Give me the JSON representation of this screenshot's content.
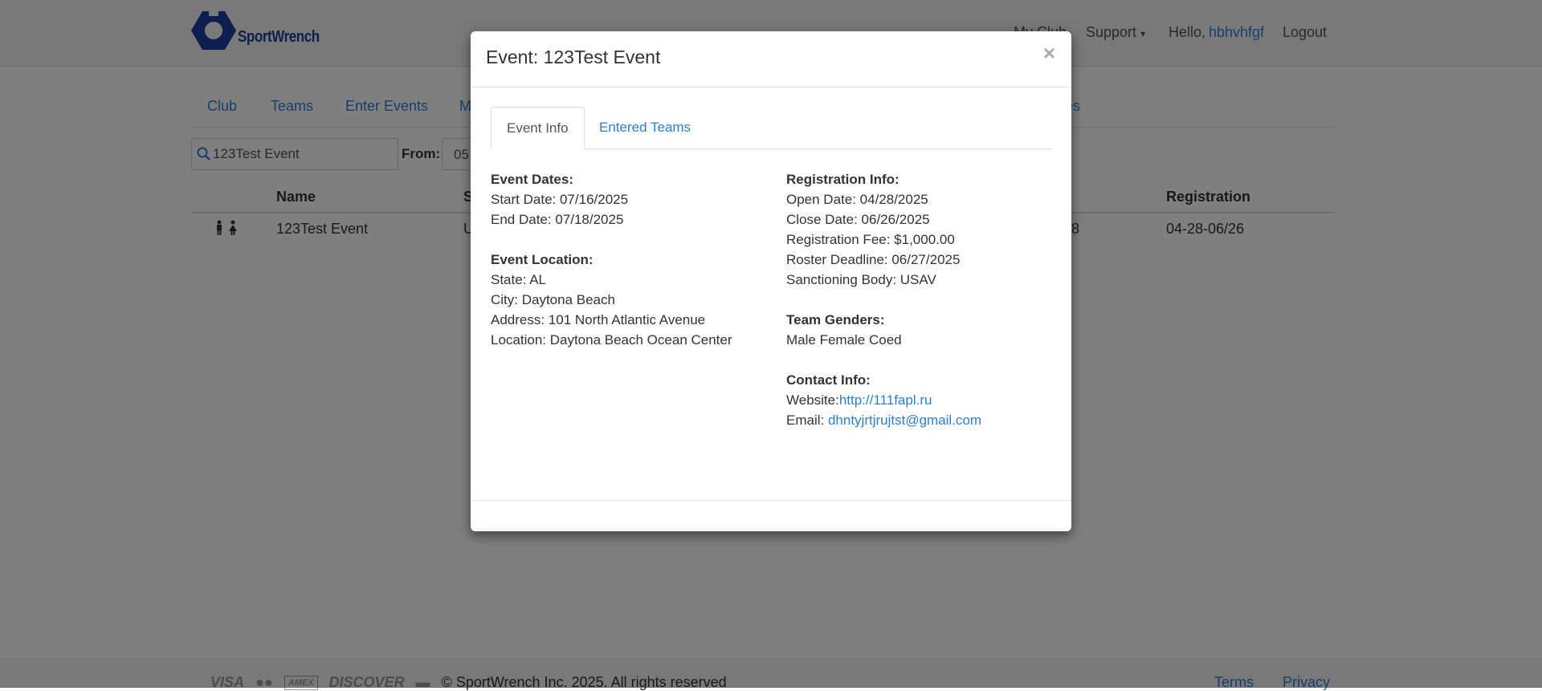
{
  "navbar": {
    "logo_text": "SportWrench",
    "my_club": "My Club",
    "support": "Support",
    "support_caret": "▾",
    "hello": "Hello,",
    "username": "hbhvhfgf",
    "logout": "Logout"
  },
  "subnav": {
    "club": "Club",
    "teams": "Teams",
    "enter_events": "Enter Events",
    "m_partial": "M",
    "es_partial": "es"
  },
  "filters": {
    "search_value": "123Test Event",
    "from_label": "From:",
    "from_value": "05"
  },
  "table": {
    "headers": {
      "name": "Name",
      "s_partial": "S",
      "registration": "Registration"
    },
    "row": {
      "name": "123Test Event",
      "u_partial": "U",
      "num_partial": "8",
      "registration": "04-28-06/26"
    }
  },
  "footer": {
    "cards": [
      "VISA",
      "●●",
      "AMEX",
      "DISCOVER",
      "▬"
    ],
    "copyright": "© SportWrench Inc. 2025. All rights reserved",
    "terms": "Terms",
    "privacy": "Privacy"
  },
  "modal": {
    "title": "Event: 123Test Event",
    "close": "×",
    "tabs": {
      "event_info": "Event Info",
      "entered_teams": "Entered Teams"
    },
    "left": {
      "dates_heading": "Event Dates:",
      "start": "Start Date: 07/16/2025",
      "end": "End Date: 07/18/2025",
      "location_heading": "Event Location:",
      "state": "State: AL",
      "city": "City: Daytona Beach",
      "address": "Address: 101 North Atlantic Avenue",
      "location": "Location: Daytona Beach Ocean Center"
    },
    "right": {
      "reg_heading": "Registration Info:",
      "open": "Open Date: 04/28/2025",
      "close": "Close Date: 06/26/2025",
      "fee": "Registration Fee: $1,000.00",
      "roster": "Roster Deadline: 06/27/2025",
      "body": "Sanctioning Body: USAV",
      "genders_heading": "Team Genders:",
      "genders": "Male Female Coed",
      "contact_heading": "Contact Info:",
      "website_label": "Website:",
      "website": "http://111fapl.ru",
      "email_label": "Email:",
      "email": "dhntyjrtjrujtst@gmail.com"
    }
  }
}
